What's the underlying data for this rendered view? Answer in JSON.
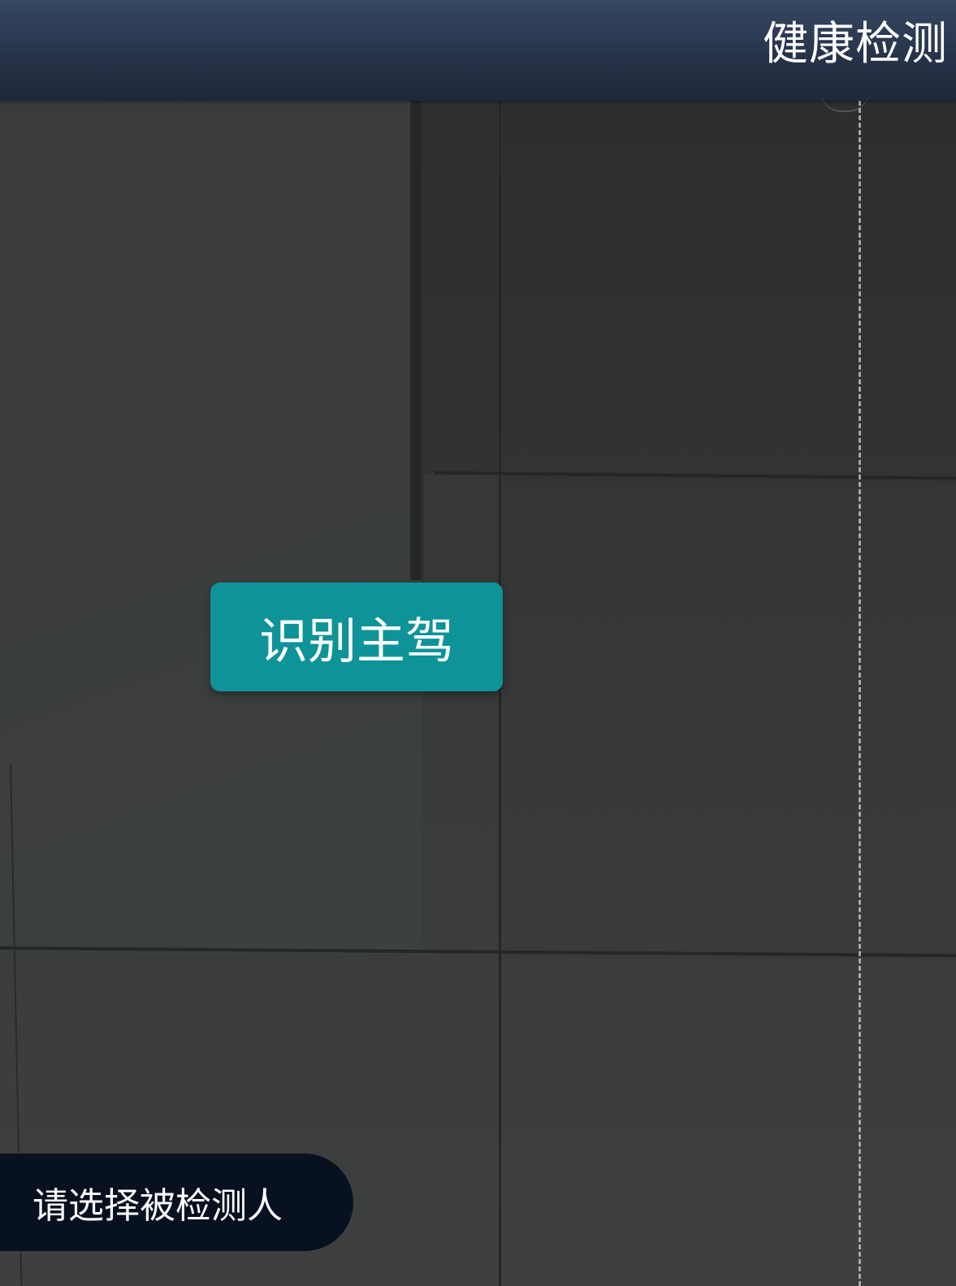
{
  "header": {
    "title": "健康检测"
  },
  "camera": {
    "identify_button_label": "识别主驾"
  },
  "bottom": {
    "select_person_label": "请选择被检测人"
  },
  "colors": {
    "header_bg": "#27334a",
    "accent_button": "#0e9399",
    "pill_bg": "#081120",
    "guide_line": "#b9bbbc"
  },
  "icons": []
}
